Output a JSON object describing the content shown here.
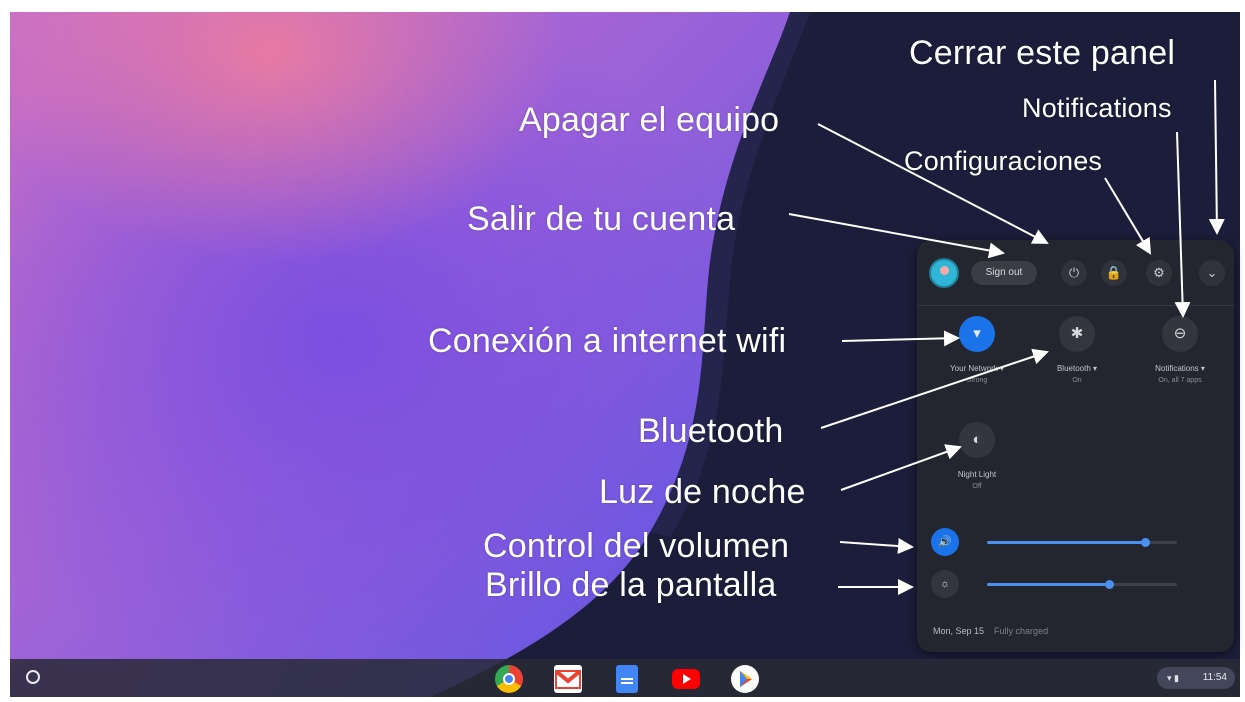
{
  "annotations": {
    "close_panel": "Cerrar este panel",
    "notifications": "Notifications",
    "power_off": "Apagar el equipo",
    "settings": "Configuraciones",
    "sign_out": "Salir de tu cuenta",
    "wifi": "Conexión a internet wifi",
    "bluetooth": "Bluetooth",
    "night_light": "Luz de noche",
    "volume": "Control del volumen",
    "brightness": "Brillo de la pantalla"
  },
  "panel": {
    "sign_out_label": "Sign out",
    "power_icon": "⏻",
    "lock_icon": "🔒",
    "settings_icon": "⚙",
    "collapse_icon": "⌄",
    "tiles": [
      {
        "label": "Your Network ▾",
        "sub": "Strong",
        "icon": "▾",
        "on": true
      },
      {
        "label": "Bluetooth ▾",
        "sub": "On",
        "icon": "✱",
        "on": false
      },
      {
        "label": "Notifications ▾",
        "sub": "On, all 7 apps",
        "icon": "⊖",
        "on": false
      },
      {
        "label": "Night Light",
        "sub": "Off",
        "icon": "◐",
        "on": false
      }
    ],
    "volume_icon": "🔊",
    "brightness_icon": "☼",
    "volume_level": 0.83,
    "brightness_level": 0.64,
    "footer_date": "Mon, Sep 15",
    "footer_info": "Fully charged"
  },
  "shelf": {
    "apps": [
      "chrome-icon",
      "gmail-icon",
      "docs-icon",
      "youtube-icon",
      "play-store-icon"
    ],
    "status_icons": "▾ ▮",
    "time": "11:54"
  },
  "colors": {
    "accent": "#1a73e8",
    "panel_bg": "#23262e"
  }
}
